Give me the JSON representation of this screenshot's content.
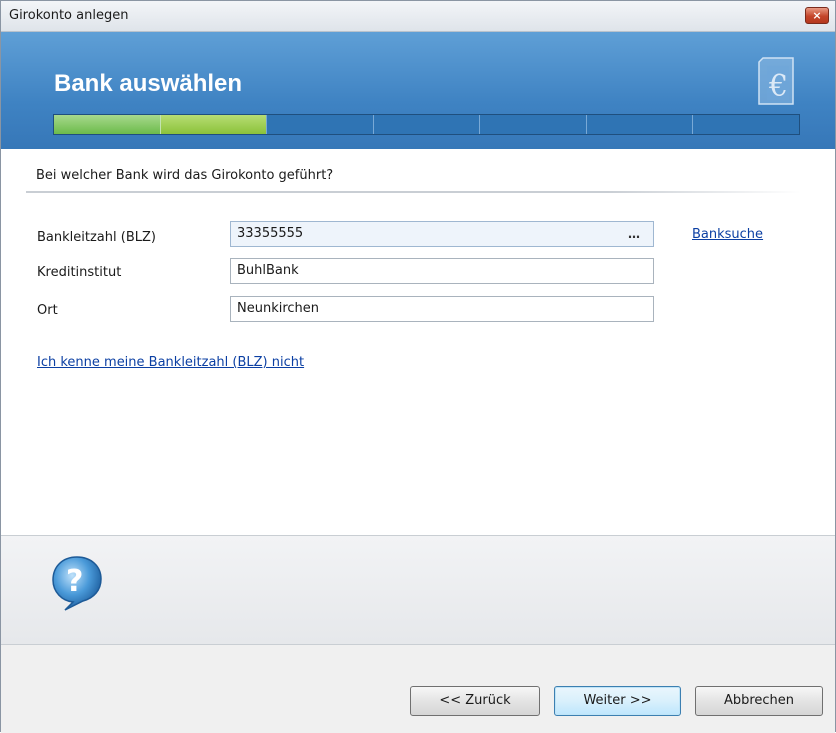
{
  "window": {
    "title": "Girokonto anlegen",
    "close_label": "×"
  },
  "header": {
    "title": "Bank auswählen",
    "progress_segments": 7,
    "progress_done": 2
  },
  "form": {
    "question": "Bei welcher Bank wird das Girokonto geführt?",
    "blz": {
      "label": "Bankleitzahl (BLZ)",
      "value": "33355555",
      "browse_label": "…"
    },
    "kreditinstitut": {
      "label": "Kreditinstitut",
      "value": "BuhlBank"
    },
    "ort": {
      "label": "Ort",
      "value": "Neunkirchen"
    },
    "banksuche_link": "Banksuche",
    "unknown_blz_link": "Ich kenne meine Bankleitzahl (BLZ) nicht"
  },
  "buttons": {
    "back": "<< Zurück",
    "next": "Weiter >>",
    "cancel": "Abbrechen"
  },
  "icons": {
    "header": "euro-document-icon",
    "help": "help-question-icon"
  }
}
